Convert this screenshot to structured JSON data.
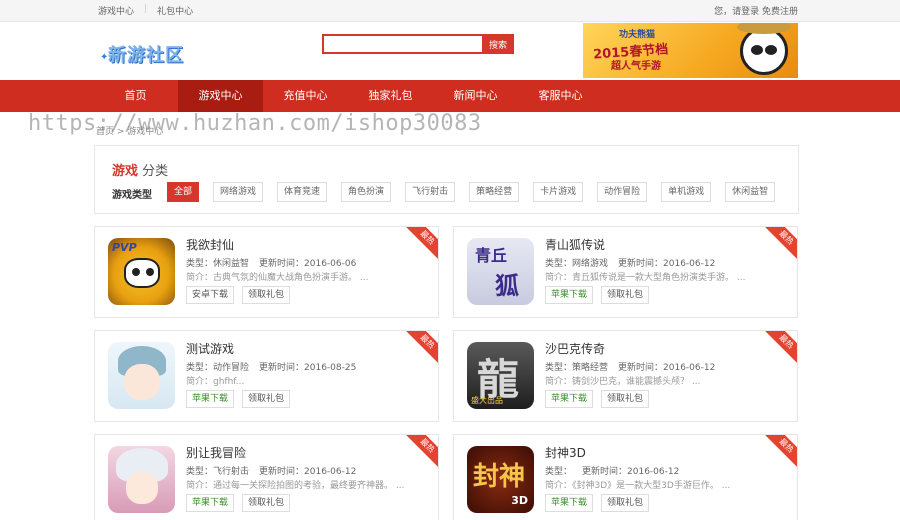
{
  "topbar": {
    "links": [
      "游戏中心",
      "礼包中心"
    ],
    "greeting": "您，请登录 免费注册"
  },
  "header": {
    "logo_text": "新游社区",
    "search_placeholder": "",
    "search_button": "搜索",
    "banner_title": "2015春节档",
    "banner_sub": "超人气手游",
    "banner_logo": "功夫熊猫"
  },
  "nav": {
    "items": [
      "首页",
      "游戏中心",
      "充值中心",
      "独家礼包",
      "新闻中心",
      "客服中心"
    ],
    "active_index": 1
  },
  "watermark": "https://www.huzhan.com/ishop30083",
  "breadcrumb": "首页 > 游戏中心",
  "category": {
    "title_highlight": "游戏",
    "title_rest": "分类",
    "type_label": "游戏类型",
    "tags": [
      "全部",
      "网络游戏",
      "体育竞速",
      "角色扮演",
      "飞行射击",
      "策略经营",
      "卡片游戏",
      "动作冒险",
      "单机游戏",
      "休闲益智"
    ]
  },
  "games": [
    {
      "name": "我欲封仙",
      "type": "类型：休闲益智",
      "updated": "更新时间：2016-06-06",
      "desc": "简介：古典气氛的仙魔大战角色扮演手游。 ...",
      "btn1": "安卓下载",
      "btn2": "领取礼包",
      "ribbon": "最热",
      "icon": "pvp-game-icon"
    },
    {
      "name": "青山狐传说",
      "type": "类型：网络游戏",
      "updated": "更新时间：2016-06-12",
      "desc": "简介：青丘狐传说是一款大型角色扮演类手游。 ...",
      "btn1": "苹果下载",
      "btn2": "领取礼包",
      "ribbon": "最热",
      "icon": "fox-game-icon"
    },
    {
      "name": "测试游戏",
      "type": "类型：动作冒险",
      "updated": "更新时间：2016-08-25",
      "desc": "简介：ghfhf...",
      "btn1": "苹果下载",
      "btn2": "领取礼包",
      "ribbon": "最热",
      "icon": "anime-boy-icon"
    },
    {
      "name": "沙巴克传奇",
      "type": "类型：策略经营",
      "updated": "更新时间：2016-06-12",
      "desc": "简介：铸剑沙巴克，谁能震撼头颅？ ...",
      "btn1": "苹果下载",
      "btn2": "领取礼包",
      "ribbon": "最热",
      "icon": "dragon-game-icon"
    },
    {
      "name": "别让我冒险",
      "type": "类型：飞行射击",
      "updated": "更新时间：2016-06-12",
      "desc": "简介：通过每一关探险拍图的考验，最终要齐神器。 ...",
      "btn1": "苹果下载",
      "btn2": "领取礼包",
      "ribbon": "最热",
      "icon": "anime-girl-icon"
    },
    {
      "name": "封神3D",
      "type": "类型：",
      "updated": "更新时间：2016-06-12",
      "desc": "简介：《封神3D》是一款大型3D手游巨作。 ...",
      "btn1": "苹果下载",
      "btn2": "领取礼包",
      "ribbon": "最热",
      "icon": "fengshen-game-icon"
    }
  ]
}
